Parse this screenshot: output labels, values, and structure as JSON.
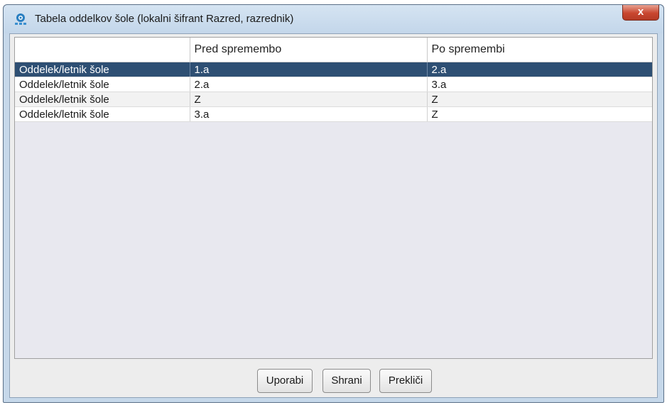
{
  "window": {
    "title": "Tabela oddelkov šole (lokalni šifrant Razred, razrednik)",
    "close_label": "x"
  },
  "table": {
    "columns": [
      "",
      "Pred spremembo",
      "Po spremembi"
    ],
    "rows": [
      {
        "label": "Oddelek/letnik šole",
        "before": "1.a",
        "after": "2.a",
        "selected": true
      },
      {
        "label": "Oddelek/letnik šole",
        "before": "2.a",
        "after": "3.a",
        "selected": false
      },
      {
        "label": "Oddelek/letnik šole",
        "before": "Z",
        "after": "Z",
        "selected": false
      },
      {
        "label": "Oddelek/letnik šole",
        "before": "3.a",
        "after": "Z",
        "selected": false
      }
    ]
  },
  "buttons": {
    "use_label": "Uporabi",
    "save_label": "Shrani",
    "cancel_label": "Prekliči"
  },
  "colors": {
    "selection": "#2e4f73",
    "highlight_frame": "#c8202a",
    "close_button": "#c9462f"
  }
}
